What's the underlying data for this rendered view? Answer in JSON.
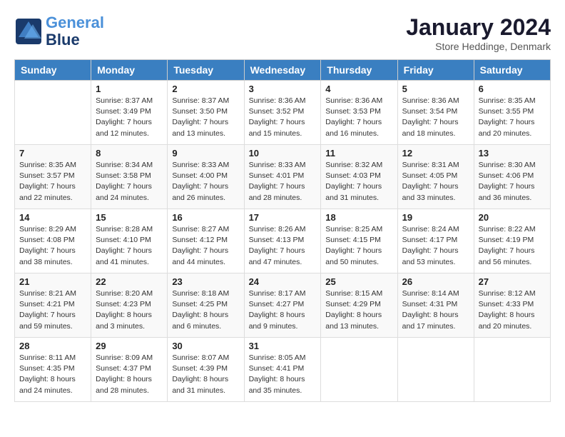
{
  "header": {
    "logo_line1": "General",
    "logo_line2": "Blue",
    "month": "January 2024",
    "location": "Store Heddinge, Denmark"
  },
  "days_of_week": [
    "Sunday",
    "Monday",
    "Tuesday",
    "Wednesday",
    "Thursday",
    "Friday",
    "Saturday"
  ],
  "weeks": [
    [
      {
        "day": "",
        "sunrise": "",
        "sunset": "",
        "daylight": ""
      },
      {
        "day": "1",
        "sunrise": "Sunrise: 8:37 AM",
        "sunset": "Sunset: 3:49 PM",
        "daylight": "Daylight: 7 hours and 12 minutes."
      },
      {
        "day": "2",
        "sunrise": "Sunrise: 8:37 AM",
        "sunset": "Sunset: 3:50 PM",
        "daylight": "Daylight: 7 hours and 13 minutes."
      },
      {
        "day": "3",
        "sunrise": "Sunrise: 8:36 AM",
        "sunset": "Sunset: 3:52 PM",
        "daylight": "Daylight: 7 hours and 15 minutes."
      },
      {
        "day": "4",
        "sunrise": "Sunrise: 8:36 AM",
        "sunset": "Sunset: 3:53 PM",
        "daylight": "Daylight: 7 hours and 16 minutes."
      },
      {
        "day": "5",
        "sunrise": "Sunrise: 8:36 AM",
        "sunset": "Sunset: 3:54 PM",
        "daylight": "Daylight: 7 hours and 18 minutes."
      },
      {
        "day": "6",
        "sunrise": "Sunrise: 8:35 AM",
        "sunset": "Sunset: 3:55 PM",
        "daylight": "Daylight: 7 hours and 20 minutes."
      }
    ],
    [
      {
        "day": "7",
        "sunrise": "Sunrise: 8:35 AM",
        "sunset": "Sunset: 3:57 PM",
        "daylight": "Daylight: 7 hours and 22 minutes."
      },
      {
        "day": "8",
        "sunrise": "Sunrise: 8:34 AM",
        "sunset": "Sunset: 3:58 PM",
        "daylight": "Daylight: 7 hours and 24 minutes."
      },
      {
        "day": "9",
        "sunrise": "Sunrise: 8:33 AM",
        "sunset": "Sunset: 4:00 PM",
        "daylight": "Daylight: 7 hours and 26 minutes."
      },
      {
        "day": "10",
        "sunrise": "Sunrise: 8:33 AM",
        "sunset": "Sunset: 4:01 PM",
        "daylight": "Daylight: 7 hours and 28 minutes."
      },
      {
        "day": "11",
        "sunrise": "Sunrise: 8:32 AM",
        "sunset": "Sunset: 4:03 PM",
        "daylight": "Daylight: 7 hours and 31 minutes."
      },
      {
        "day": "12",
        "sunrise": "Sunrise: 8:31 AM",
        "sunset": "Sunset: 4:05 PM",
        "daylight": "Daylight: 7 hours and 33 minutes."
      },
      {
        "day": "13",
        "sunrise": "Sunrise: 8:30 AM",
        "sunset": "Sunset: 4:06 PM",
        "daylight": "Daylight: 7 hours and 36 minutes."
      }
    ],
    [
      {
        "day": "14",
        "sunrise": "Sunrise: 8:29 AM",
        "sunset": "Sunset: 4:08 PM",
        "daylight": "Daylight: 7 hours and 38 minutes."
      },
      {
        "day": "15",
        "sunrise": "Sunrise: 8:28 AM",
        "sunset": "Sunset: 4:10 PM",
        "daylight": "Daylight: 7 hours and 41 minutes."
      },
      {
        "day": "16",
        "sunrise": "Sunrise: 8:27 AM",
        "sunset": "Sunset: 4:12 PM",
        "daylight": "Daylight: 7 hours and 44 minutes."
      },
      {
        "day": "17",
        "sunrise": "Sunrise: 8:26 AM",
        "sunset": "Sunset: 4:13 PM",
        "daylight": "Daylight: 7 hours and 47 minutes."
      },
      {
        "day": "18",
        "sunrise": "Sunrise: 8:25 AM",
        "sunset": "Sunset: 4:15 PM",
        "daylight": "Daylight: 7 hours and 50 minutes."
      },
      {
        "day": "19",
        "sunrise": "Sunrise: 8:24 AM",
        "sunset": "Sunset: 4:17 PM",
        "daylight": "Daylight: 7 hours and 53 minutes."
      },
      {
        "day": "20",
        "sunrise": "Sunrise: 8:22 AM",
        "sunset": "Sunset: 4:19 PM",
        "daylight": "Daylight: 7 hours and 56 minutes."
      }
    ],
    [
      {
        "day": "21",
        "sunrise": "Sunrise: 8:21 AM",
        "sunset": "Sunset: 4:21 PM",
        "daylight": "Daylight: 7 hours and 59 minutes."
      },
      {
        "day": "22",
        "sunrise": "Sunrise: 8:20 AM",
        "sunset": "Sunset: 4:23 PM",
        "daylight": "Daylight: 8 hours and 3 minutes."
      },
      {
        "day": "23",
        "sunrise": "Sunrise: 8:18 AM",
        "sunset": "Sunset: 4:25 PM",
        "daylight": "Daylight: 8 hours and 6 minutes."
      },
      {
        "day": "24",
        "sunrise": "Sunrise: 8:17 AM",
        "sunset": "Sunset: 4:27 PM",
        "daylight": "Daylight: 8 hours and 9 minutes."
      },
      {
        "day": "25",
        "sunrise": "Sunrise: 8:15 AM",
        "sunset": "Sunset: 4:29 PM",
        "daylight": "Daylight: 8 hours and 13 minutes."
      },
      {
        "day": "26",
        "sunrise": "Sunrise: 8:14 AM",
        "sunset": "Sunset: 4:31 PM",
        "daylight": "Daylight: 8 hours and 17 minutes."
      },
      {
        "day": "27",
        "sunrise": "Sunrise: 8:12 AM",
        "sunset": "Sunset: 4:33 PM",
        "daylight": "Daylight: 8 hours and 20 minutes."
      }
    ],
    [
      {
        "day": "28",
        "sunrise": "Sunrise: 8:11 AM",
        "sunset": "Sunset: 4:35 PM",
        "daylight": "Daylight: 8 hours and 24 minutes."
      },
      {
        "day": "29",
        "sunrise": "Sunrise: 8:09 AM",
        "sunset": "Sunset: 4:37 PM",
        "daylight": "Daylight: 8 hours and 28 minutes."
      },
      {
        "day": "30",
        "sunrise": "Sunrise: 8:07 AM",
        "sunset": "Sunset: 4:39 PM",
        "daylight": "Daylight: 8 hours and 31 minutes."
      },
      {
        "day": "31",
        "sunrise": "Sunrise: 8:05 AM",
        "sunset": "Sunset: 4:41 PM",
        "daylight": "Daylight: 8 hours and 35 minutes."
      },
      {
        "day": "",
        "sunrise": "",
        "sunset": "",
        "daylight": ""
      },
      {
        "day": "",
        "sunrise": "",
        "sunset": "",
        "daylight": ""
      },
      {
        "day": "",
        "sunrise": "",
        "sunset": "",
        "daylight": ""
      }
    ]
  ]
}
